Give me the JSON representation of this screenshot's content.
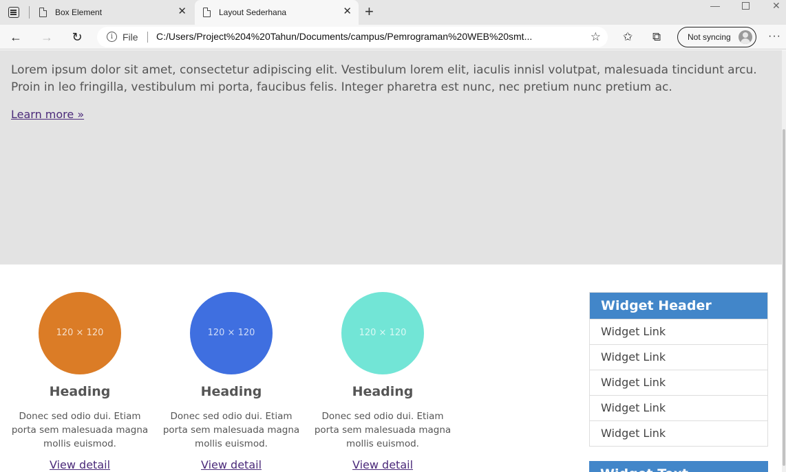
{
  "browser": {
    "tabs": [
      {
        "title": "Box Element",
        "close": "✕"
      },
      {
        "title": "Layout Sederhana",
        "close": "✕"
      }
    ],
    "new_tab": "+",
    "address": {
      "scheme_label": "File",
      "url": "C:/Users/Project%204%20Tahun/Documents/campus/Pemrograman%20WEB%20smt..."
    },
    "sync_label": "Not syncing",
    "more_label": "···"
  },
  "jumbotron": {
    "text": "Lorem ipsum dolor sit amet, consectetur adipiscing elit. Vestibulum lorem elit, iaculis innisl volutpat, malesuada tincidunt arcu. Proin in leo fringilla, vestibulum mi porta, faucibus felis. Integer pharetra est nunc, nec pretium nunc pretium ac.",
    "link": "Learn more »"
  },
  "features": [
    {
      "placeholder": "120 × 120",
      "heading": "Heading",
      "body": "Donec sed odio dui. Etiam porta sem malesuada magna mollis euismod.",
      "link": "View detail",
      "color": "#db7c26"
    },
    {
      "placeholder": "120 × 120",
      "heading": "Heading",
      "body": "Donec sed odio dui. Etiam porta sem malesuada magna mollis euismod.",
      "link": "View detail",
      "color": "#3f6fe0"
    },
    {
      "placeholder": "120 × 120",
      "heading": "Heading",
      "body": "Donec sed odio dui. Etiam porta sem malesuada magna mollis euismod.",
      "link": "View detail",
      "color": "#72e5d6"
    }
  ],
  "widget": {
    "header": "Widget Header",
    "links": [
      "Widget Link",
      "Widget Link",
      "Widget Link",
      "Widget Link",
      "Widget Link"
    ]
  },
  "widget2": {
    "header": "Widget Text"
  },
  "colors": {
    "accent": "#4286c9",
    "link": "#4b2a7a",
    "jumbotron_bg": "#e3e3e3"
  }
}
